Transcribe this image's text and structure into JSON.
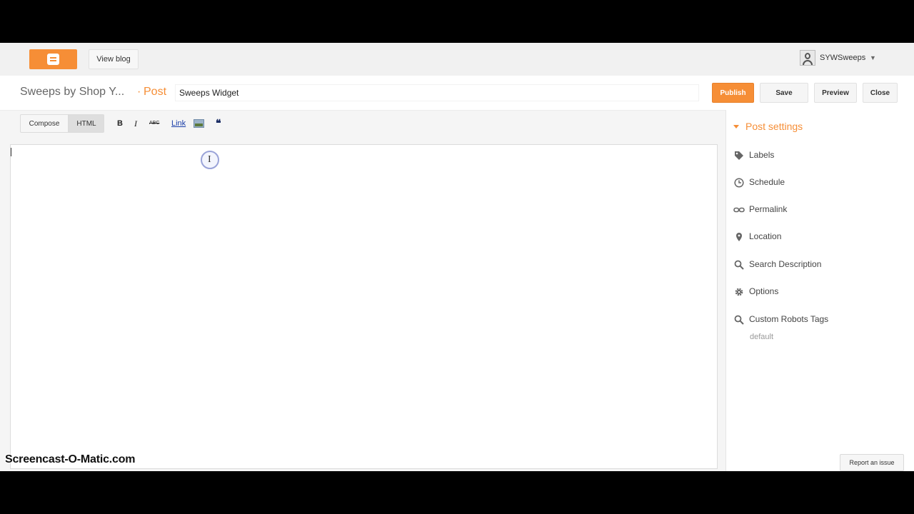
{
  "topbar": {
    "view_blog_label": "View blog",
    "username": "SYWSweeps"
  },
  "titlebar": {
    "blog_title": "Sweeps by Shop Y...",
    "separator": "·",
    "post_label": "Post",
    "post_title_value": "Sweeps Widget",
    "publish_label": "Publish",
    "save_label": "Save",
    "preview_label": "Preview",
    "close_label": "Close"
  },
  "toolbar": {
    "compose_label": "Compose",
    "html_label": "HTML",
    "active_mode": "HTML",
    "bold_label": "B",
    "italic_label": "I",
    "strike_label": "ABC",
    "link_label": "Link",
    "quote_label": "❝"
  },
  "editor": {
    "content": ""
  },
  "post_settings": {
    "header": "Post settings",
    "items": [
      {
        "label": "Labels",
        "icon": "tag-icon"
      },
      {
        "label": "Schedule",
        "icon": "clock-icon"
      },
      {
        "label": "Permalink",
        "icon": "link-icon"
      },
      {
        "label": "Location",
        "icon": "pin-icon"
      },
      {
        "label": "Search Description",
        "icon": "search-icon"
      },
      {
        "label": "Options",
        "icon": "gear-icon"
      },
      {
        "label": "Custom Robots Tags",
        "icon": "search-icon"
      }
    ],
    "robots_value": "default"
  },
  "footer": {
    "report_label": "Report an issue",
    "watermark": "Screencast-O-Matic.com"
  },
  "colors": {
    "accent": "#f68e36",
    "link": "#1a3ea8"
  }
}
